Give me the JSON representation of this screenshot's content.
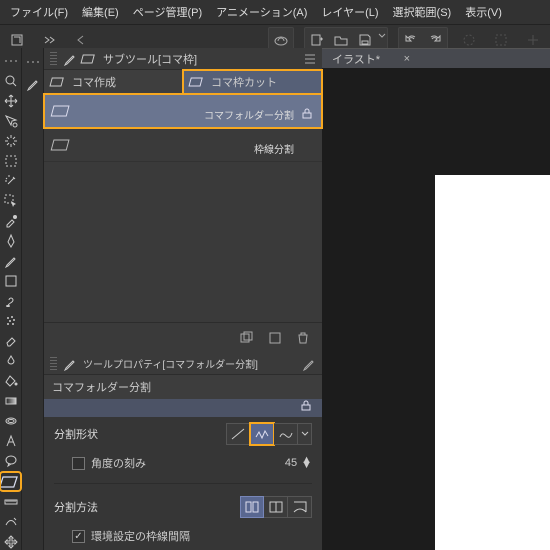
{
  "menu": {
    "file": "ファイル(F)",
    "edit": "編集(E)",
    "page": "ページ管理(P)",
    "anim": "アニメーション(A)",
    "layer": "レイヤー(L)",
    "select": "選択範囲(S)",
    "view": "表示(V)"
  },
  "doc": {
    "title": "イラスト*"
  },
  "subtool": {
    "panel_title": "サブツール[コマ枠]",
    "tab_create": "コマ作成",
    "tab_cut": "コマ枠カット",
    "item_split": "コマフォルダー分割",
    "cat_border": "枠線分割"
  },
  "prop": {
    "panel_title": "ツールプロパティ[コマフォルダー分割]",
    "group": "コマフォルダー分割",
    "shape": "分割形状",
    "angle": "角度の刻み",
    "angle_val": "45",
    "method": "分割方法",
    "env": "環境設定の枠線間隔"
  }
}
